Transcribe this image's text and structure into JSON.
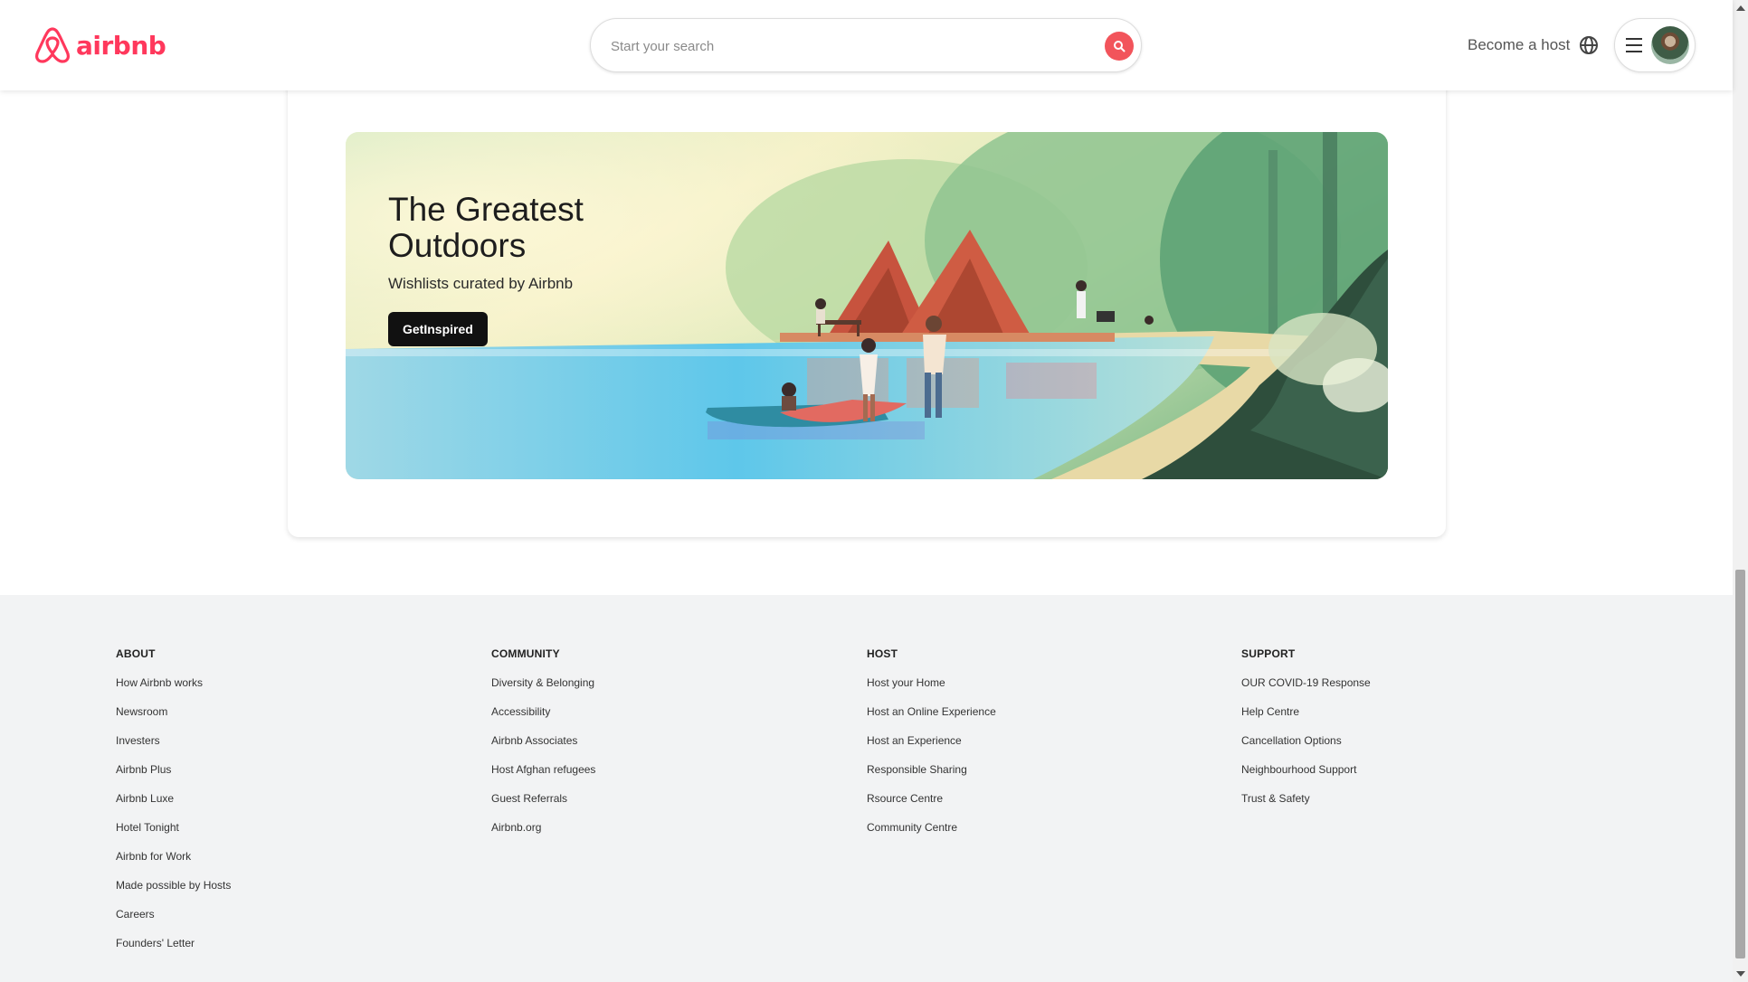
{
  "header": {
    "logo_text": "airbnb",
    "search_placeholder": "Start your search",
    "become_host": "Become a host",
    "brand_color": "#ff385c"
  },
  "banner": {
    "title": "The Greatest Outdoors",
    "subtitle": "Wishlists curated by Airbnb",
    "button_label": "GetInspired"
  },
  "footer": {
    "columns": [
      {
        "heading": "ABOUT",
        "links": [
          "How Airbnb works",
          "Newsroom",
          "Investers",
          "Airbnb Plus",
          "Airbnb Luxe",
          "Hotel Tonight",
          "Airbnb for Work",
          "Made possible by Hosts",
          "Careers",
          "Founders' Letter"
        ]
      },
      {
        "heading": "COMMUNITY",
        "links": [
          "Diversity & Belonging",
          "Accessibility",
          "Airbnb Associates",
          "Host Afghan refugees",
          "Guest Referrals",
          "Airbnb.org"
        ]
      },
      {
        "heading": "HOST",
        "links": [
          "Host your Home",
          "Host an Online Experience",
          "Host an Experience",
          "Responsible Sharing",
          "Rsource Centre",
          "Community Centre"
        ]
      },
      {
        "heading": "SUPPORT",
        "links": [
          "OUR COVID-19 Response",
          "Help Centre",
          "Cancellation Options",
          "Neighbourhood Support",
          "Trust & Safety"
        ]
      }
    ]
  },
  "icons": {
    "logo": "airbnb-logo-icon",
    "search": "search-icon",
    "globe": "globe-icon",
    "menu": "hamburger-menu-icon",
    "avatar": "user-avatar"
  }
}
